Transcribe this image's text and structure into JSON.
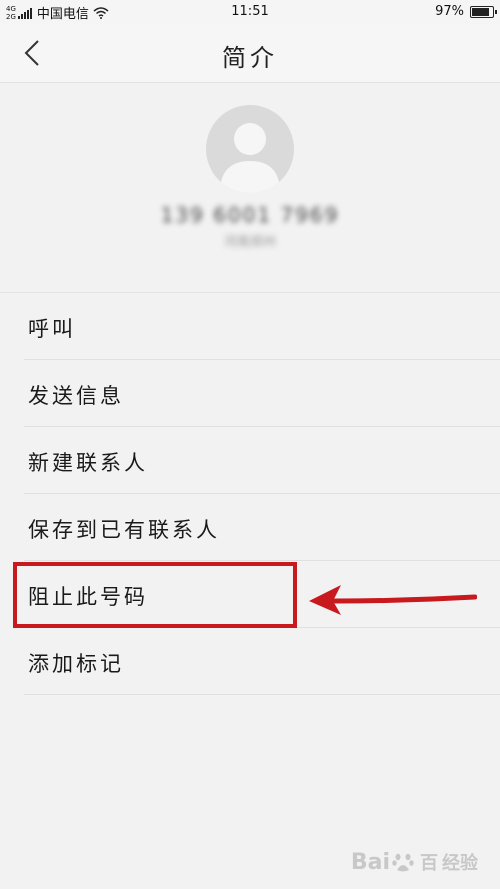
{
  "status_bar": {
    "network_top": "4G",
    "network_bottom": "2G",
    "carrier": "中国电信",
    "time": "11:51",
    "battery": "97%",
    "battery_level": 0.97
  },
  "nav": {
    "title": "简介"
  },
  "profile": {
    "phone_number": "139 6001 7969",
    "location": "河南郑州"
  },
  "menu": {
    "items": [
      {
        "label": "呼叫"
      },
      {
        "label": "发送信息"
      },
      {
        "label": "新建联系人"
      },
      {
        "label": "保存到已有联系人"
      },
      {
        "label": "阻止此号码"
      },
      {
        "label": "添加标记"
      }
    ]
  },
  "annotation": {
    "highlight_color": "#c8191f"
  },
  "watermark": {
    "brand": "Bai",
    "brand_end": "百",
    "suffix": "经验"
  }
}
